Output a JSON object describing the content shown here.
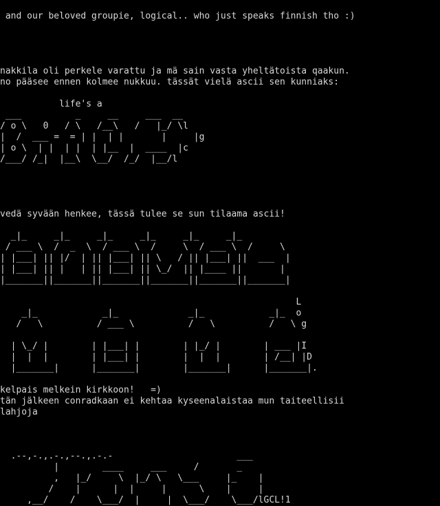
{
  "text_color": "#d8d8d8",
  "background_color": "#000000",
  "lines": [
    " and our beloved groupie, logical.. who just speaks finnish tho :)",
    "",
    "",
    "",
    "",
    "nakkila oli perkele varattu ja mä sain vasta yheltätoista qaakun.",
    "no pääsee ennen kolmee nukkuu. tässät vielä ascii sen kunniaks:",
    "",
    "           life's a",
    " ___          _     __     ___  __",
    "/ o \\   0   / \\   /__\\   /   |_/ \\l",
    "|  /  ___ =  = | |  | |       |     |g",
    "| o \\  | |  | |  | |__  |  ____  |c",
    "/___/ /_|  |__\\  \\__/  /_/  |__/l",
    "",
    "",
    "",
    "",
    "vedä syvään henkee, tässä tulee se sun tilaama ascii!",
    "",
    "  _|_     _|_     _|_     _|_     _|_     _|_",
    " / ___ \\  /  _  \\  / ___ \\  /     \\  / ___ \\  /     \\",
    "| |___| || |/  | || |___| || \\   / || |___| ||  ___  |",
    "| |___| || |   | || |___| || \\_/  || |____ ||       |",
    "|_______||_______||_______||_______||_______||_______|",
    "                                                       L",
    "    _|_            _|_             _|_            _|_  o",
    "   /   \\          / ___ \\          /   \\          /   \\ g",
    "  | \\_/ |        | |___| |        | |_/ |        | ___ |I",
    "  |  |  |        | |___| |        |  |  |        | /__| |D",
    "  |_______|      |_______|        |_______|      |_______|.",
    "",
    "kelpais melkein kirkkoon!   =)",
    "tän jälkeen conradkaan ei kehtaa kyseenalaistaa mun taiteellisii",
    "lahjoja",
    "",
    "",
    "",
    "  .--,-.,.-.,--.,.-.-                       ___",
    "          |        ____     ___     /       _",
    "          ,   |_/     \\  |_/ \\   \\___     |_    |",
    "         /    |      |  |     |      \\    |     |",
    "     ,__/    /    \\___/  |     |  \\___/    \\___/lGCL!1"
  ]
}
